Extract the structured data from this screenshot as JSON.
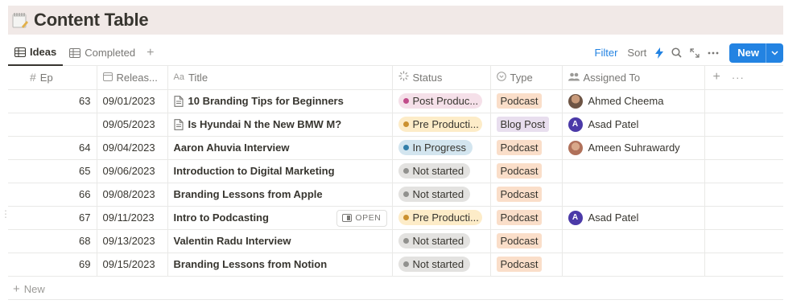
{
  "page": {
    "title": "Content Table"
  },
  "tabs": [
    {
      "label": "Ideas",
      "active": true
    },
    {
      "label": "Completed",
      "active": false
    }
  ],
  "toolbar": {
    "filter": "Filter",
    "sort": "Sort",
    "new_label": "New"
  },
  "columns": [
    "Ep",
    "Releas...",
    "Title",
    "Status",
    "Type",
    "Assigned To"
  ],
  "status_colors": {
    "Post Production": {
      "bg": "#f5e0e9",
      "dot": "#c14c8a"
    },
    "Pre Production": {
      "bg": "#fdecc8",
      "dot": "#cb912f"
    },
    "In Progress": {
      "bg": "#d3e5ef",
      "dot": "#337ea9"
    },
    "Not started": {
      "bg": "#e3e2e0",
      "dot": "#91918e"
    }
  },
  "type_colors": {
    "Podcast": "#fadec9",
    "Blog Post": "#e8deee"
  },
  "rows": [
    {
      "ep": "63",
      "release": "09/01/2023",
      "title": "10 Branding Tips for Beginners",
      "has_page_icon": true,
      "status": "Post Produc...",
      "status_key": "Post Production",
      "type": "Podcast",
      "assignee": "Ahmed Cheema",
      "avatar": "photo1"
    },
    {
      "ep": "",
      "release": "09/05/2023",
      "title": "Is Hyundai N the New BMW M?",
      "has_page_icon": true,
      "status": "Pre Producti...",
      "status_key": "Pre Production",
      "type": "Blog Post",
      "assignee": "Asad Patel",
      "avatar": "A"
    },
    {
      "ep": "64",
      "release": "09/04/2023",
      "title": "Aaron Ahuvia Interview",
      "has_page_icon": false,
      "status": "In Progress",
      "status_key": "In Progress",
      "type": "Podcast",
      "assignee": "Ameen Suhrawardy",
      "avatar": "photo2"
    },
    {
      "ep": "65",
      "release": "09/06/2023",
      "title": "Introduction to Digital Marketing",
      "has_page_icon": false,
      "status": "Not started",
      "status_key": "Not started",
      "type": "Podcast",
      "assignee": "",
      "avatar": ""
    },
    {
      "ep": "66",
      "release": "09/08/2023",
      "title": "Branding Lessons from Apple",
      "has_page_icon": false,
      "status": "Not started",
      "status_key": "Not started",
      "type": "Podcast",
      "assignee": "",
      "avatar": ""
    },
    {
      "ep": "67",
      "release": "09/11/2023",
      "title": "Intro to Podcasting",
      "has_page_icon": false,
      "open_label": "OPEN",
      "status": "Pre Producti...",
      "status_key": "Pre Production",
      "type": "Podcast",
      "assignee": "Asad Patel",
      "avatar": "A"
    },
    {
      "ep": "68",
      "release": "09/13/2023",
      "title": "Valentin Radu Interview",
      "has_page_icon": false,
      "status": "Not started",
      "status_key": "Not started",
      "type": "Podcast",
      "assignee": "",
      "avatar": ""
    },
    {
      "ep": "69",
      "release": "09/15/2023",
      "title": "Branding Lessons from Notion",
      "has_page_icon": false,
      "status": "Not started",
      "status_key": "Not started",
      "type": "Podcast",
      "assignee": "",
      "avatar": ""
    }
  ],
  "new_row_label": "New",
  "accent": "#2383e2"
}
